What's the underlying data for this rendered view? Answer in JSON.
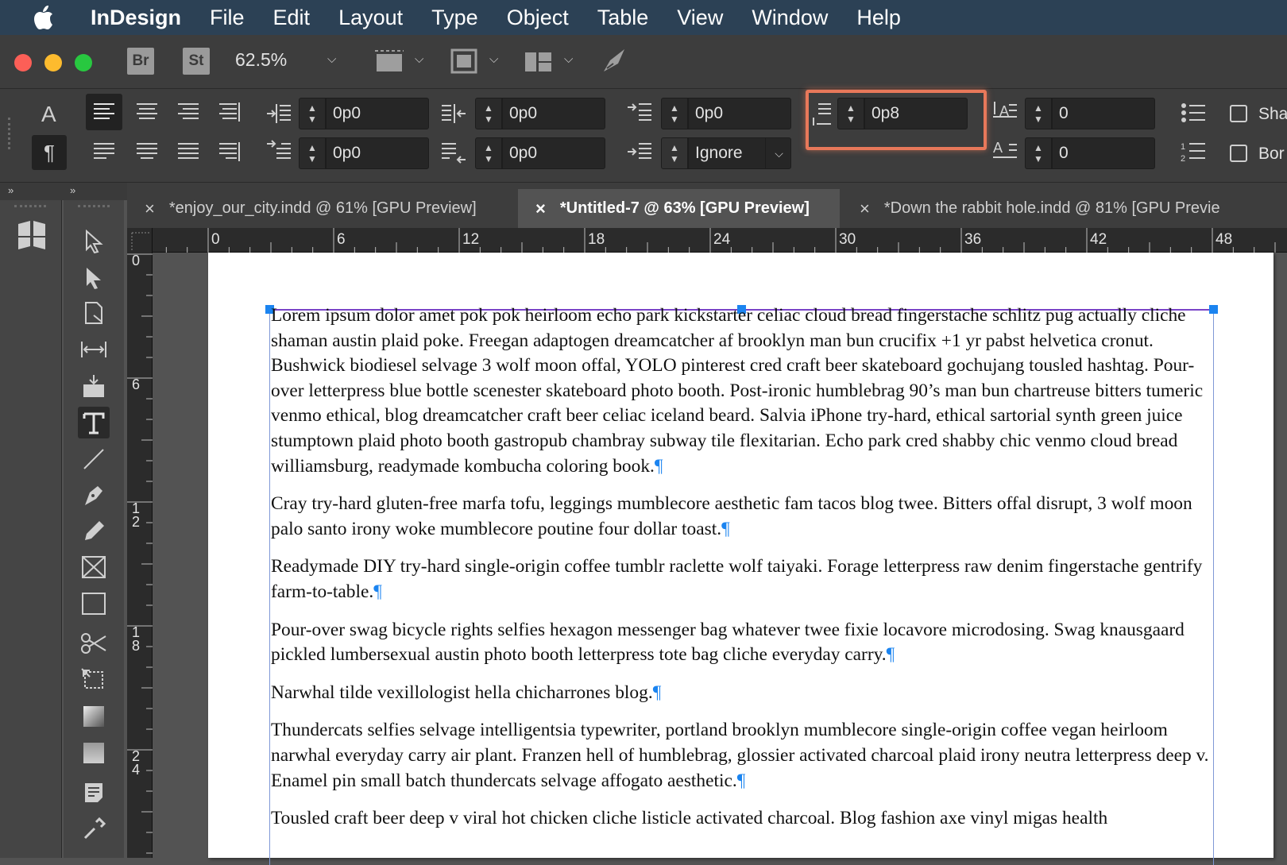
{
  "menubar": {
    "app_name": "InDesign",
    "items": [
      "File",
      "Edit",
      "Layout",
      "Type",
      "Object",
      "Table",
      "View",
      "Window",
      "Help"
    ]
  },
  "appbar": {
    "bridge_label": "Br",
    "stock_label": "St",
    "zoom": "62.5%"
  },
  "control_panel": {
    "left_indent": "0p0",
    "right_indent": "0p0",
    "first_line_indent": "0p0",
    "last_line_indent": "0p0",
    "space_before": "0p0",
    "space_after": "0p8",
    "align_to_grid": "Ignore",
    "drop_cap_lines": "0",
    "drop_cap_chars": "0",
    "shading_label": "Sha",
    "border_label": "Bor"
  },
  "tabs": [
    {
      "label": "*enjoy_our_city.indd @ 61% [GPU Preview]",
      "active": false
    },
    {
      "label": "*Untitled-7 @ 63% [GPU Preview]",
      "active": true
    },
    {
      "label": "*Down the rabbit hole.indd @ 81% [GPU Previe",
      "active": false
    }
  ],
  "ruler": {
    "h_marks": [
      "0",
      "6",
      "12",
      "18",
      "24",
      "30",
      "36",
      "42",
      "48"
    ],
    "v_marks": [
      "0",
      "6",
      "12",
      "18",
      "24"
    ]
  },
  "document": {
    "paragraphs": [
      "Lorem ipsum dolor amet pok pok heirloom echo park kickstarter celiac cloud bread fingerstache schlitz pug actually cliche shaman austin plaid poke. Freegan adaptogen dreamcatcher af brooklyn man bun crucifix +1 yr pabst helvetica cronut. Bushwick biodiesel selvage 3 wolf moon offal, YOLO pinterest cred craft beer skateboard gochujang tousled hashtag. Pour-over letterpress blue bottle scenester skateboard photo booth. Post-ironic humblebrag 90’s man bun chartreuse bitters tumeric venmo ethical, blog dreamcatcher craft beer celiac iceland beard. Salvia iPhone try-hard, ethical sartorial synth green juice stumptown plaid photo booth gastropub chambray subway tile flexitarian. Echo park cred shabby chic venmo cloud bread williamsburg, readymade kombucha coloring book.",
      "Cray try-hard gluten-free marfa tofu, leggings mumblecore aesthetic fam tacos blog twee. Bitters offal disrupt, 3 wolf moon palo santo irony woke mumblecore poutine four dollar toast.",
      "Readymade DIY try-hard single-origin coffee tumblr raclette wolf taiyaki. Forage letterpress raw denim fingerstache gentrify farm-to-table.",
      "Pour-over swag bicycle rights selfies hexagon messenger bag whatever twee fixie locavore microdosing. Swag knausgaard pickled lumbersexual austin photo booth letterpress tote bag cliche everyday carry.",
      "Narwhal tilde vexillologist hella chicharrones blog.",
      "Thundercats selfies selvage intelligentsia typewriter, portland brooklyn mumblecore single-origin coffee vegan heirloom narwhal everyday carry air plant. Franzen hell of humblebrag, glossier activated charcoal plaid irony neutra letterpress deep v. Enamel pin small batch thundercats selvage affogato aesthetic.",
      "Tousled craft beer deep v viral hot chicken cliche listicle activated charcoal. Blog fashion axe vinyl migas health"
    ],
    "pilcrow": "¶"
  },
  "colors": {
    "menubar": "#2c4155",
    "highlight": "#e8785a",
    "frame_top": "#7a44c8",
    "handle": "#1b84f0"
  }
}
